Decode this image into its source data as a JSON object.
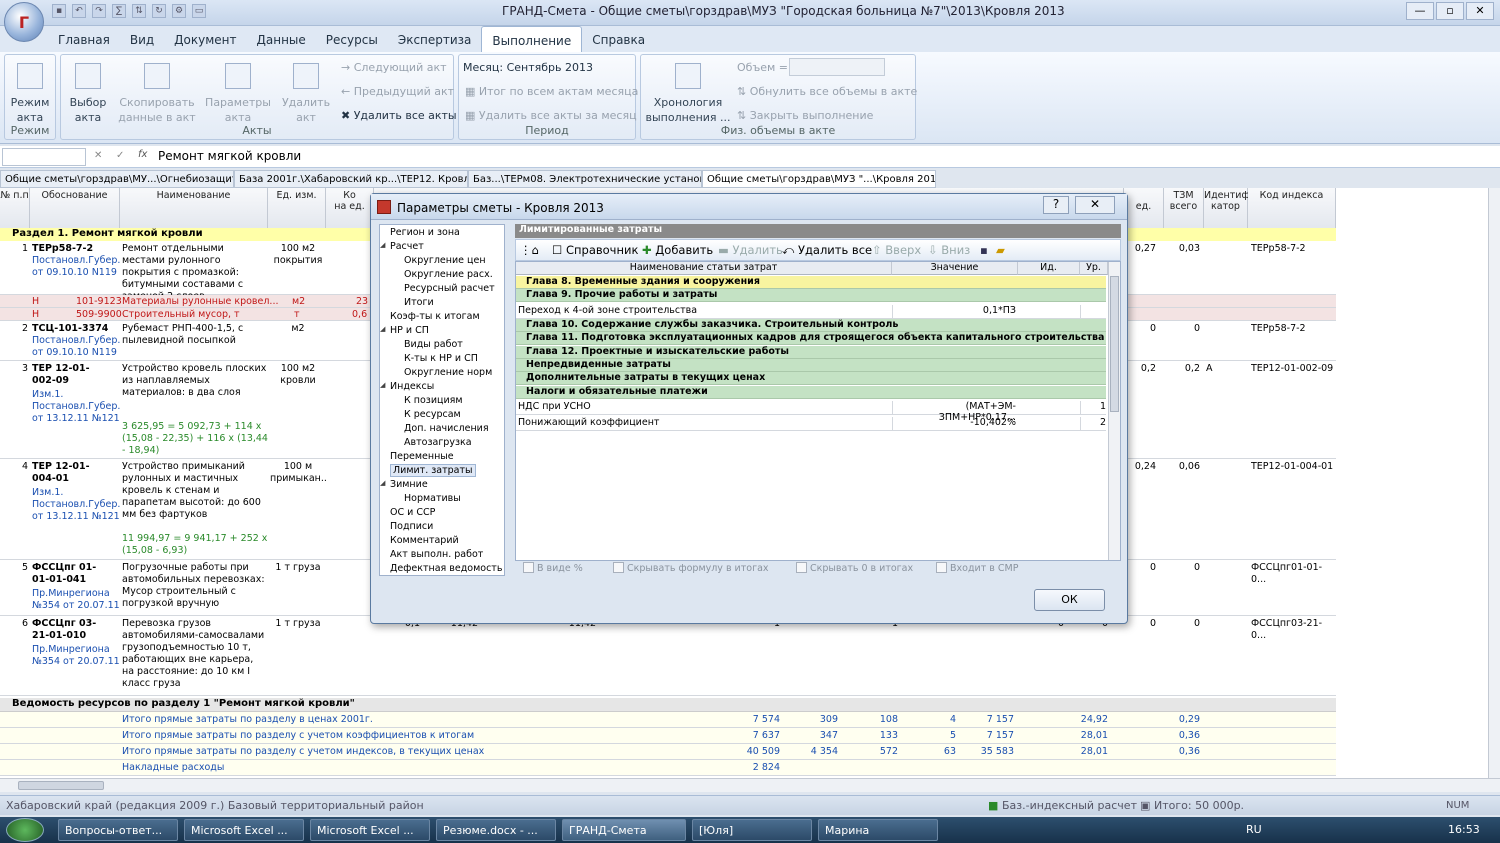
{
  "app": {
    "title": "ГРАНД-Смета - Общие сметы\\горздрав\\МУЗ \"Городская больница №7\"\\2013\\Кровля 2013"
  },
  "ribbon_tabs": [
    "Главная",
    "Вид",
    "Документ",
    "Данные",
    "Ресурсы",
    "Экспертиза",
    "Выполнение",
    "Справка"
  ],
  "ribbon": {
    "mode_btn": "Режим акта",
    "mode_group": "Режим",
    "select_act": "Выбор акта",
    "copy_data": "Скопировать данные в акт",
    "act_params": "Параметры акта",
    "delete_act": "Удалить акт",
    "next_act": "Следующий акт",
    "prev_act": "Предыдущий акт",
    "delete_all_acts": "Удалить все акты",
    "acts_group": "Акты",
    "month": "Месяц: Сентябрь 2013",
    "total_all_acts": "Итог по всем актам месяца",
    "delete_month_acts": "Удалить все акты за месяц",
    "period_group": "Период",
    "chronology": "Хронология выполнения ...",
    "volume_label": "Объем =",
    "reset_volumes": "Обнулить все объемы в акте",
    "close_execution": "Закрыть выполнение",
    "phys_group": "Физ. объемы в акте"
  },
  "formula": {
    "value": "Ремонт мягкой кровли"
  },
  "doc_tabs": [
    "Общие сметы\\горздрав\\МУ...\\Огнебиозащита",
    "База 2001г.\\Хабаровский кр...\\ТЕР12. Кровли",
    "Баз...\\ТЕРм08. Электротехнические установки",
    "Общие сметы\\горздрав\\МУЗ \"...\\Кровля 2013"
  ],
  "columns": {
    "num": "№ п.п",
    "basis": "Обоснование",
    "name": "Наименование",
    "unit": "Ед. изм.",
    "qty": "Ко",
    "per_unit": "на ед.",
    "tzm": "ТЗМ",
    "tzm_unit": "ед.",
    "tzm_all": "всего",
    "ident": "Идентифи катор",
    "index_code": "Код индекса"
  },
  "section1": "Раздел 1. Ремонт мягкой кровли",
  "rows": [
    {
      "n": "1",
      "code": "ТЕРр58-7-2",
      "src": "Постановл.Губер... от 09.10.10 N119",
      "name": "Ремонт отдельными местами рулонного покрытия с промазкой: битумными составами с заменой 2 слоев",
      "unit": "100 м2 покрытия",
      "t1": "0,27",
      "t2": "0,03",
      "idx": "ТЕРр58-7-2"
    },
    {
      "n": "2",
      "code": "ТСЦ-101-3374",
      "src": "Постановл.Губер... от 09.10.10 N119",
      "name": "Рубемаст РНП-400-1,5, с пылевидной посыпкой",
      "unit": "м2",
      "t1": "0",
      "t2": "0",
      "idx": "ТЕРр58-7-2"
    },
    {
      "n": "3",
      "code": "ТЕР 12-01-002-09",
      "src": "Изм.1. Постановл.Губер... от 13.12.11 №121",
      "name": "Устройство кровель плоских из наплавляемых материалов: в два слоя",
      "formula": "3 625,95 = 5 092,73 + 114 x (15,08 - 22,35) + 116 x (13,44 - 18,94)",
      "unit": "100 м2 кровли",
      "t1": "0,2",
      "t2": "0,2",
      "id": "А",
      "idx": "ТЕР12-01-002-09"
    },
    {
      "n": "4",
      "code": "ТЕР 12-01-004-01",
      "src": "Изм.1. Постановл.Губер... от 13.12.11 №121",
      "name": "Устройство примыканий рулонных и мастичных кровель к стенам и парапетам высотой: до 600 мм без фартуков",
      "formula": "11 994,97 = 9 941,17 + 252 x (15,08 - 6,93)",
      "unit": "100 м примыкан...",
      "t1": "0,24",
      "t2": "0,06",
      "idx": "ТЕР12-01-004-01"
    },
    {
      "n": "5",
      "code": "ФССЦпг 01-01-01-041",
      "src": "Пр.Минрегиона №354 от 20.07.11",
      "name": "Погрузочные работы при автомобильных перевозках: Мусор строительный с погрузкой вручную",
      "unit": "1 т груза",
      "t1": "0",
      "t2": "0",
      "idx": "ФССЦпг01-01-0..."
    },
    {
      "n": "6",
      "code": "ФССЦпг 03-21-01-010",
      "src": "Пр.Минрегиона №354 от 20.07.11",
      "name": "Перевозка грузов автомобилями-самосвалами грузоподъемностью 10 т, работающих вне карьера, на расстояние: до 10 км I класс груза",
      "unit": "1 т груза",
      "t1": "0",
      "t2": "0",
      "idx": "ФССЦпг03-21-0..."
    }
  ],
  "subrows": [
    {
      "h": "Н",
      "code": "101-9123",
      "name": "Материалы рулонные кровел...",
      "unit": "м2",
      "v": "23"
    },
    {
      "h": "Н",
      "code": "509-9900",
      "name": "Строительный мусор, т",
      "unit": "т",
      "v": "0,6"
    }
  ],
  "row6_vals": [
    "0,1",
    "11,42",
    "11,42",
    "1",
    "1",
    "0",
    "0"
  ],
  "resources_title": "Ведомость ресурсов по разделу 1 \"Ремонт мягкой кровли\"",
  "totals": [
    {
      "label": "Итого прямые затраты по разделу в ценах 2001г.",
      "v": [
        "7 574",
        "309",
        "108",
        "4",
        "7 157",
        "",
        "24,92",
        "0,29"
      ]
    },
    {
      "label": "Итого прямые затраты по разделу с учетом коэффициентов к итогам",
      "v": [
        "7 637",
        "347",
        "133",
        "5",
        "7 157",
        "",
        "28,01",
        "0,36"
      ]
    },
    {
      "label": "Итого прямые затраты по разделу с учетом индексов, в текущих ценах",
      "v": [
        "40 509",
        "4 354",
        "572",
        "63",
        "35 583",
        "",
        "28,01",
        "0,36"
      ]
    },
    {
      "label": "Накладные расходы",
      "v": [
        "2 824",
        "",
        "",
        "",
        "",
        "",
        "",
        ""
      ]
    }
  ],
  "dialog": {
    "title": "Параметры сметы - Кровля 2013",
    "tree": [
      {
        "t": "Регион и зона",
        "l": 0
      },
      {
        "t": "Расчет",
        "l": 0,
        "exp": "◢"
      },
      {
        "t": "Округление цен",
        "l": 1
      },
      {
        "t": "Округление расх.",
        "l": 1
      },
      {
        "t": "Ресурсный расчет",
        "l": 1
      },
      {
        "t": "Итоги",
        "l": 1
      },
      {
        "t": "Коэф-ты к итогам",
        "l": 0
      },
      {
        "t": "НР и СП",
        "l": 0,
        "exp": "◢"
      },
      {
        "t": "Виды работ",
        "l": 1
      },
      {
        "t": "К-ты к НР и СП",
        "l": 1
      },
      {
        "t": "Округление норм",
        "l": 1
      },
      {
        "t": "Индексы",
        "l": 0,
        "exp": "◢"
      },
      {
        "t": "К позициям",
        "l": 1
      },
      {
        "t": "К ресурсам",
        "l": 1
      },
      {
        "t": "Доп. начисления",
        "l": 1
      },
      {
        "t": "Автозагрузка",
        "l": 1
      },
      {
        "t": "Переменные",
        "l": 0
      },
      {
        "t": "Лимит. затраты",
        "l": 0,
        "sel": true
      },
      {
        "t": "Зимние",
        "l": 0,
        "exp": "◢"
      },
      {
        "t": "Нормативы",
        "l": 1
      },
      {
        "t": "ОС и ССР",
        "l": 0
      },
      {
        "t": "Подписи",
        "l": 0
      },
      {
        "t": "Комментарий",
        "l": 0
      },
      {
        "t": "Акт выполн. работ",
        "l": 0
      },
      {
        "t": "Дефектная ведомость",
        "l": 0
      }
    ],
    "panel_header": "Лимитированные затраты",
    "toolbar": {
      "ref": "Справочник",
      "add": "Добавить",
      "delete": "Удалить",
      "delete_all": "Удалить все",
      "up": "Вверх",
      "down": "Вниз"
    },
    "grid_cols": {
      "name": "Наименование статьи затрат",
      "value": "Значение",
      "id": "Ид.",
      "level": "Ур."
    },
    "grid_rows": [
      {
        "type": "yel",
        "text": "Глава 8. Временные здания и сооружения"
      },
      {
        "type": "grp",
        "text": "Глава 9. Прочие работы и затраты"
      },
      {
        "type": "w",
        "text": "Переход к 4-ой зоне строительства",
        "value": "0,1*ПЗ",
        "lvl": ""
      },
      {
        "type": "grp",
        "text": "Глава 10. Содержание службы заказчика. Строительный контроль"
      },
      {
        "type": "grp",
        "text": "Глава 11. Подготовка эксплуатационных кадров для строящегося объекта капитального строительства"
      },
      {
        "type": "grp",
        "text": "Глава 12. Проектные и изыскательские работы"
      },
      {
        "type": "grp",
        "text": "Непредвиденные затраты"
      },
      {
        "type": "grp",
        "text": "Дополнительные затраты в текущих ценах"
      },
      {
        "type": "grp",
        "text": "Налоги и обязательные платежи"
      },
      {
        "type": "w",
        "text": "НДС при УСНО",
        "value": "(МАТ+ЭМ-ЗПМ+НР*0,17...",
        "lvl": "1"
      },
      {
        "type": "w",
        "text": "Понижающий коэффициент",
        "value": "-10,402%",
        "lvl": "2"
      }
    ],
    "checks": [
      "В виде %",
      "Скрывать формулу в итогах",
      "Скрывать 0 в итогах",
      "Входит в СМР"
    ],
    "ok": "ОК"
  },
  "status": {
    "region": "Хабаровский край (редакция 2009 г.)  Базовый территориальный район",
    "mode": "Баз.-индексный расчет",
    "total": "Итого: 50 000р.",
    "num": "NUM"
  },
  "taskbar": {
    "items": [
      "Вопросы-ответ...",
      "Microsoft Excel ...",
      "Microsoft Excel ...",
      "Резюме.docx - ...",
      "ГРАНД-Смета",
      "[Юля]",
      "Марина"
    ],
    "lang": "RU",
    "time": "16:53"
  }
}
